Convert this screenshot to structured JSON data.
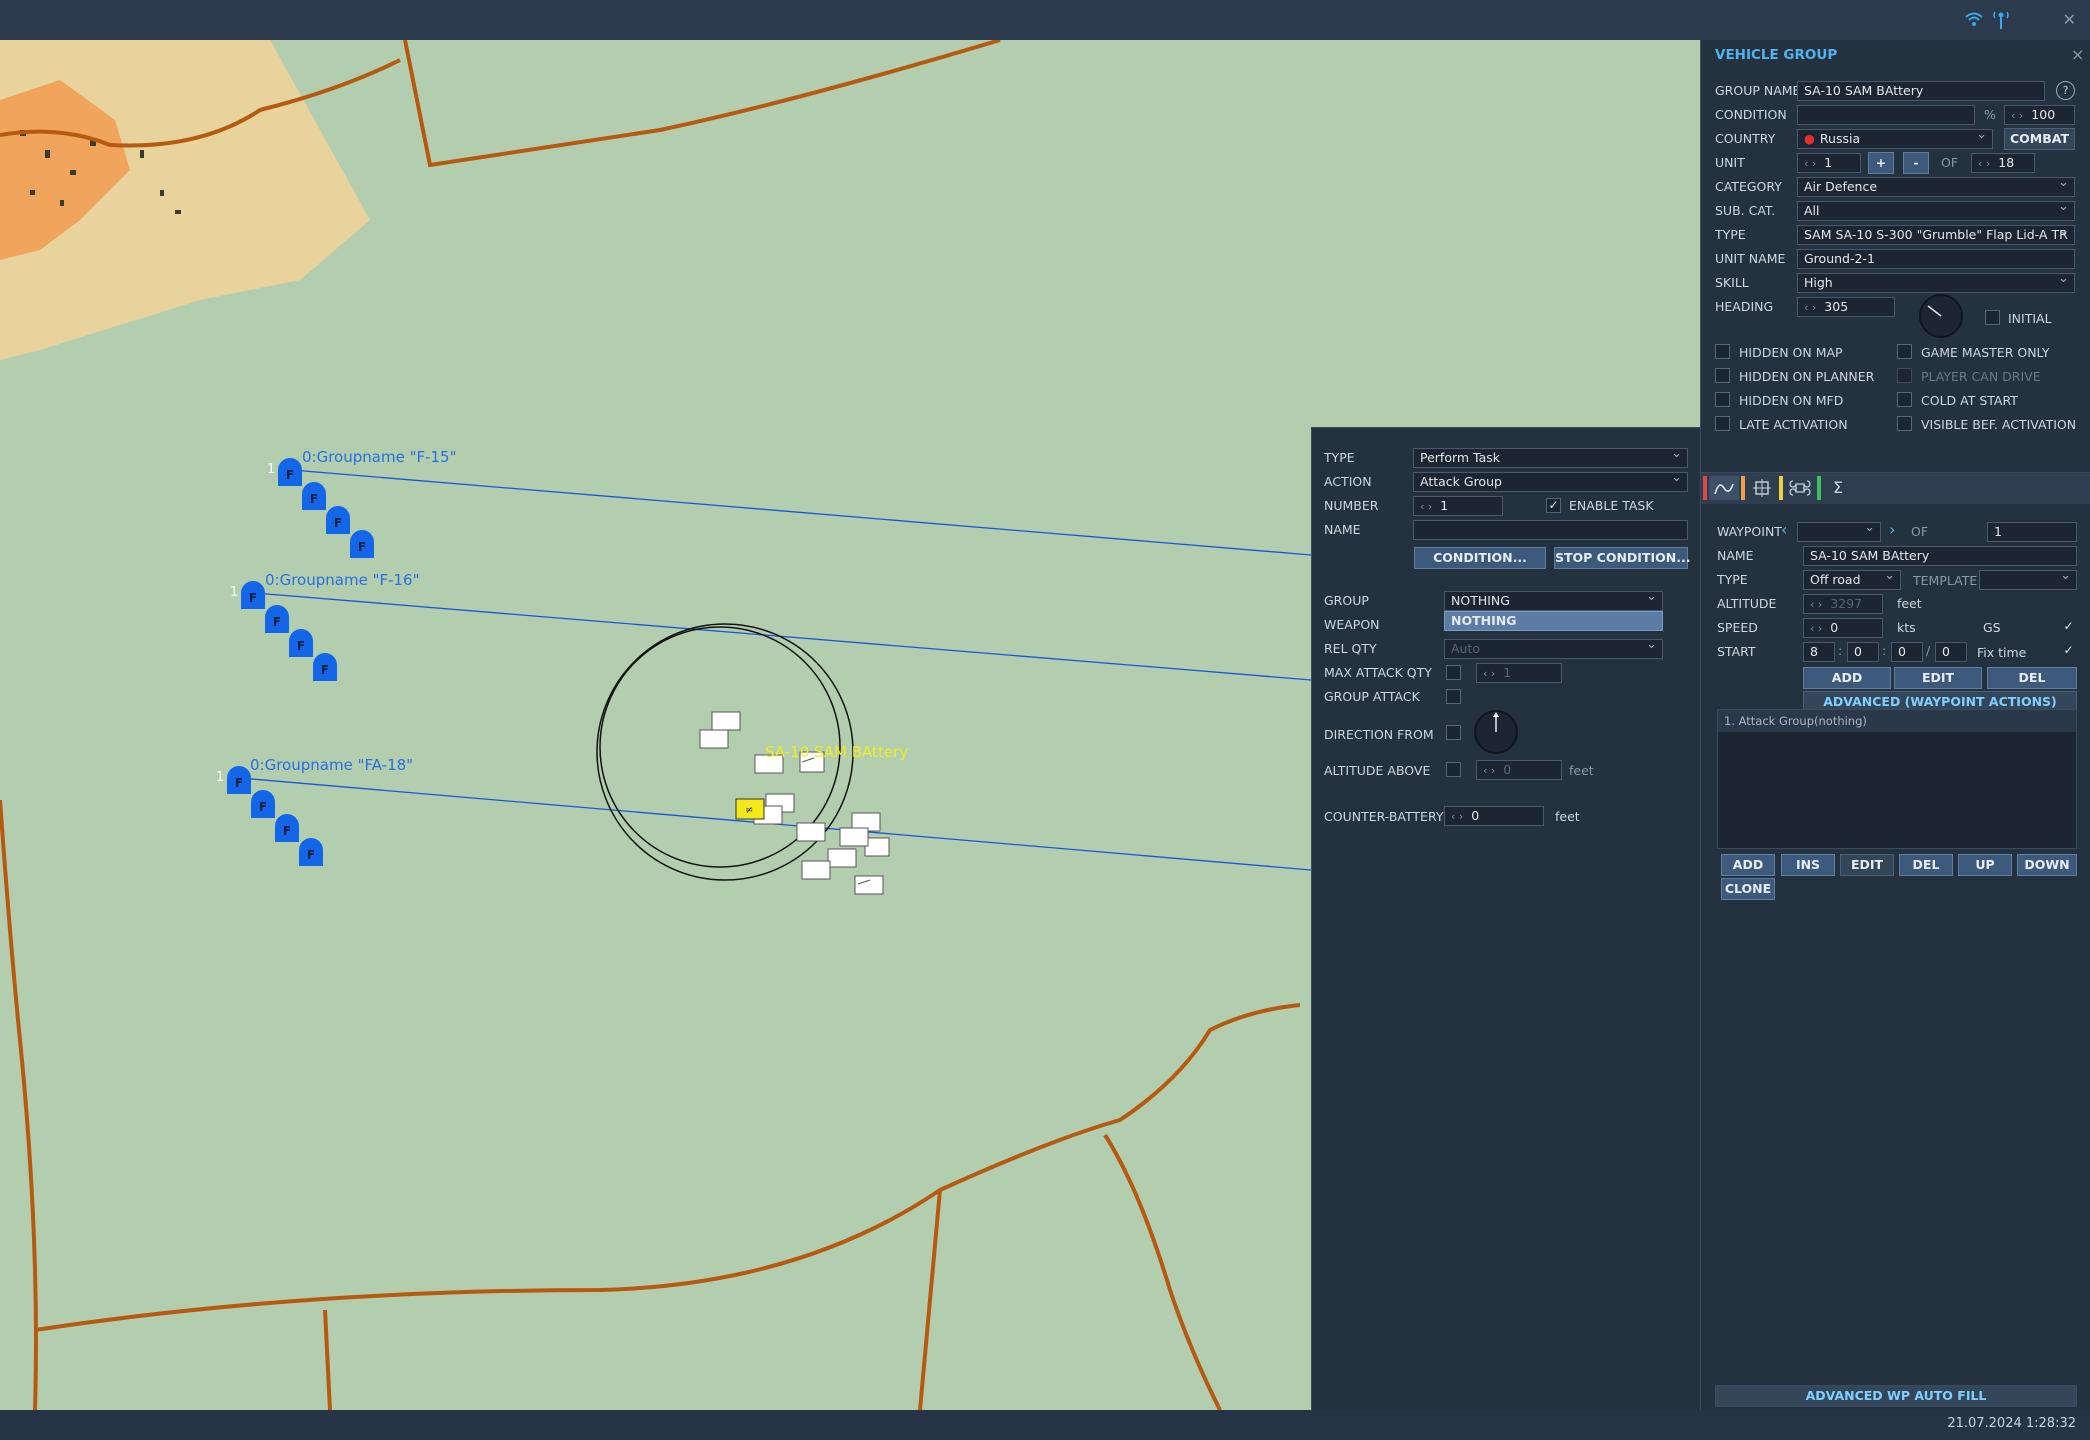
{
  "topbar": {
    "close_glyph": "✕"
  },
  "map": {
    "groups": [
      {
        "label": "0:Groupname \"F-15\"",
        "index": "1",
        "marker": "F"
      },
      {
        "label": "0:Groupname \"F-16\"",
        "index": "1",
        "marker": "F"
      },
      {
        "label": "0:Groupname \"FA-18\"",
        "index": "1",
        "marker": "F"
      }
    ],
    "sam_label": "SA-10 SAM BAttery"
  },
  "vehicle_group": {
    "title": "VEHICLE GROUP",
    "close": "×",
    "group_name_label": "GROUP NAME",
    "group_name": "SA-10 SAM BAttery",
    "help": "?",
    "condition_label": "CONDITION",
    "condition_value": "",
    "percent": "%",
    "condition_max": "100",
    "country_label": "COUNTRY",
    "country": "Russia",
    "combat": "COMBAT",
    "unit_label": "UNIT",
    "unit": "1",
    "plus": "+",
    "minus": "-",
    "of": "OF",
    "unit_total": "18",
    "category_label": "CATEGORY",
    "category": "Air Defence",
    "subcat_label": "SUB. CAT.",
    "subcat": "All",
    "type_label": "TYPE",
    "type": "SAM SA-10 S-300 \"Grumble\" Flap Lid-A TR",
    "unit_name_label": "UNIT NAME",
    "unit_name": "Ground-2-1",
    "skill_label": "SKILL",
    "skill": "High",
    "heading_label": "HEADING",
    "heading": "305",
    "initial": "INITIAL",
    "options": [
      {
        "label": "HIDDEN ON MAP",
        "checked": false,
        "disabled": false
      },
      {
        "label": "GAME MASTER ONLY",
        "checked": false,
        "disabled": false
      },
      {
        "label": "HIDDEN ON PLANNER",
        "checked": false,
        "disabled": false
      },
      {
        "label": "PLAYER CAN DRIVE",
        "checked": false,
        "disabled": true
      },
      {
        "label": "HIDDEN ON MFD",
        "checked": false,
        "disabled": false
      },
      {
        "label": "COLD AT START",
        "checked": false,
        "disabled": false
      },
      {
        "label": "LATE ACTIVATION",
        "checked": false,
        "disabled": false
      },
      {
        "label": "VISIBLE BEF. ACTIVATION",
        "checked": false,
        "disabled": false
      }
    ],
    "tab_colors": [
      "#e0484c",
      "#f0a040",
      "#e8d040",
      "#40c060"
    ],
    "waypoint": {
      "label": "WAYPOINT",
      "value": "",
      "of": "OF",
      "total": "1",
      "name_label": "NAME",
      "name": "SA-10 SAM BAttery",
      "type_label": "TYPE",
      "type": "Off road",
      "template_label": "TEMPLATE",
      "template": "",
      "altitude_label": "ALTITUDE",
      "altitude": "3297",
      "altitude_unit": "feet",
      "speed_label": "SPEED",
      "speed": "0",
      "speed_unit": "kts",
      "gs": "GS",
      "start_label": "START",
      "start_d": "8",
      "start_h": "0",
      "start_m": "0",
      "start_s": "0",
      "fix_time": "Fix time",
      "add": "ADD",
      "edit": "EDIT",
      "del": "DEL",
      "advanced": "ADVANCED (WAYPOINT ACTIONS)"
    },
    "action_list": [
      "1. Attack Group(nothing)"
    ],
    "list_buttons": {
      "add": "ADD",
      "ins": "INS",
      "edit": "EDIT",
      "del": "DEL",
      "up": "UP",
      "down": "DOWN",
      "clone": "CLONE"
    },
    "autofill": "ADVANCED WP AUTO FILL"
  },
  "task": {
    "type_label": "TYPE",
    "type": "Perform Task",
    "action_label": "ACTION",
    "action": "Attack Group",
    "number_label": "NUMBER",
    "number": "1",
    "enable_task": "ENABLE TASK",
    "name_label": "NAME",
    "name": "",
    "condition_btn": "CONDITION...",
    "stop_condition_btn": "STOP CONDITION...",
    "group_label": "GROUP",
    "group": "NOTHING",
    "group_option": "NOTHING",
    "weapon_label": "WEAPON",
    "relqty_label": "REL QTY",
    "relqty": "Auto",
    "max_attack_label": "MAX ATTACK QTY",
    "max_attack": "1",
    "group_attack_label": "GROUP ATTACK",
    "direction_label": "DIRECTION FROM",
    "altitude_label": "ALTITUDE ABOVE",
    "altitude": "0",
    "altitude_unit": "feet",
    "counter_label": "COUNTER-BATTERY",
    "counter": "0",
    "counter_unit": "feet"
  },
  "status": {
    "datetime": "21.07.2024 1:28:32"
  }
}
